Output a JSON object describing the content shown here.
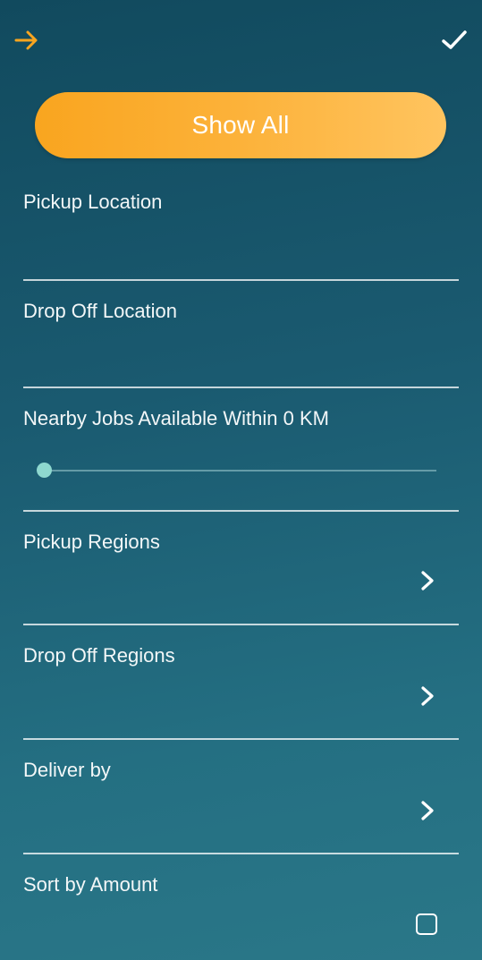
{
  "header": {
    "back_icon": "arrow-right-icon",
    "confirm_icon": "check-icon",
    "accent_color": "#f9a51f"
  },
  "show_all": {
    "label": "Show All"
  },
  "pickup_location": {
    "label": "Pickup Location",
    "value": ""
  },
  "dropoff_location": {
    "label": "Drop Off Location",
    "value": ""
  },
  "nearby": {
    "label": "Nearby Jobs Available Within 0 KM",
    "value_km": 0
  },
  "pickup_regions": {
    "label": "Pickup Regions",
    "icon": "chevron-right-icon"
  },
  "dropoff_regions": {
    "label": "Drop Off Regions",
    "icon": "chevron-right-icon"
  },
  "deliver_by": {
    "label": "Deliver by",
    "icon": "chevron-right-icon"
  },
  "sort_by_amount": {
    "label": "Sort by Amount",
    "checked": false
  }
}
